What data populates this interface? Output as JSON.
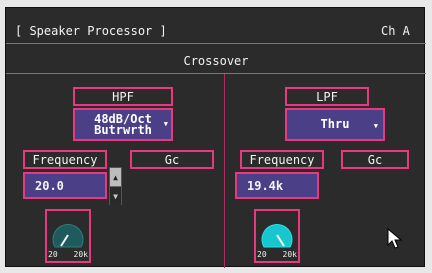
{
  "header": {
    "title": "[ Speaker Processor ]",
    "channel": "Ch A",
    "section": "Crossover"
  },
  "hpf": {
    "label": "HPF",
    "slope": [
      "48dB/Oct",
      "Butrwrth"
    ],
    "frequency_label": "Frequency",
    "gc_label": "Gc",
    "frequency_value": "20.0",
    "knob_min": "20",
    "knob_max": "20k"
  },
  "lpf": {
    "label": "LPF",
    "slope": "Thru",
    "frequency_label": "Frequency",
    "gc_label": "Gc",
    "frequency_value": "19.4k",
    "knob_min": "20",
    "knob_max": "20k"
  },
  "colors": {
    "panel": "#2b2b2b",
    "accent": "#e8397e",
    "value_bg": "#4b3f87",
    "knob_hpf": "#1f5a5c",
    "knob_lpf": "#18c6cf"
  }
}
